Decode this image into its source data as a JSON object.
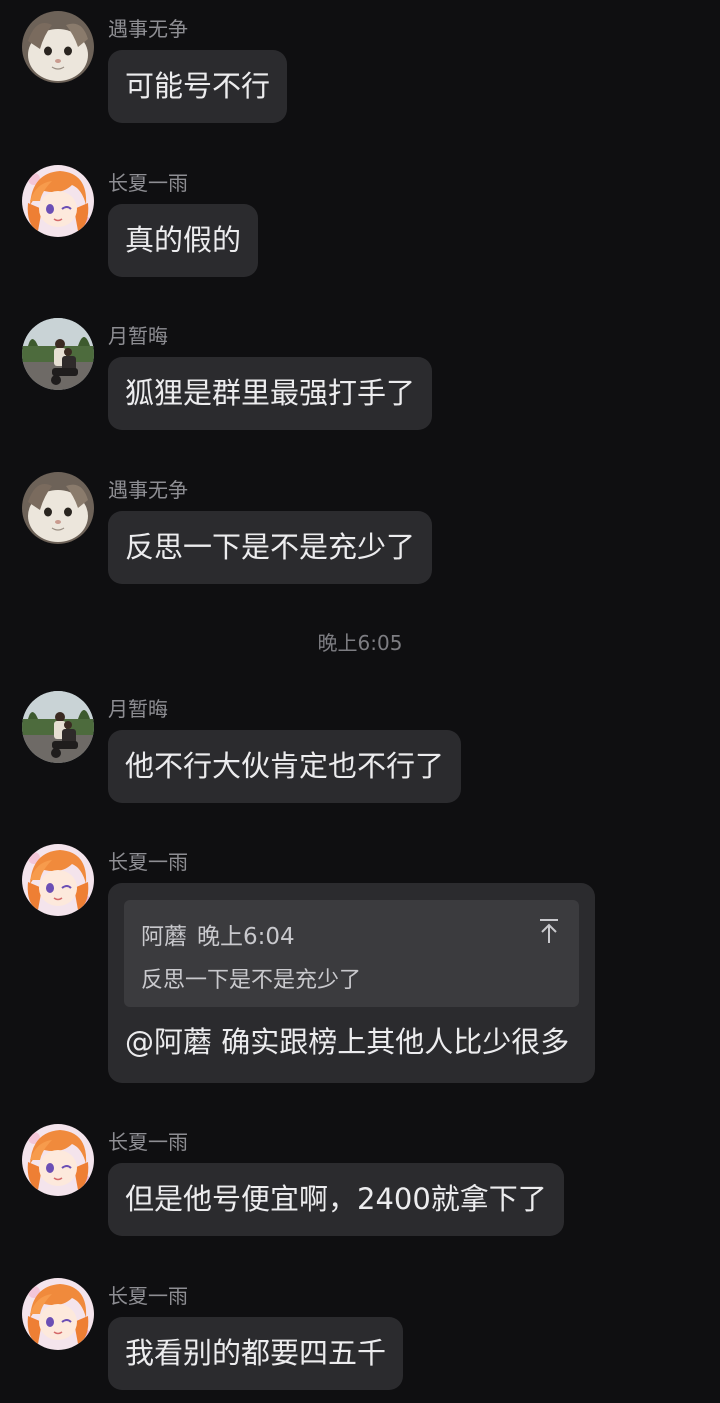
{
  "colors": {
    "background": "#0f0f11",
    "bubble": "#2b2b2e",
    "quote_bg": "#3b3b3e",
    "sender_text": "#8e8e93",
    "message_text": "#ececee"
  },
  "messages": [
    {
      "sender": "遇事无争",
      "text": "可能号不行",
      "avatar": "cat-avatar"
    },
    {
      "sender": "长夏一雨",
      "text": "真的假的",
      "avatar": "anime-girl-avatar"
    },
    {
      "sender": "月暂晦",
      "text": "狐狸是群里最强打手了",
      "avatar": "photo-avatar"
    },
    {
      "sender": "遇事无争",
      "text": "反思一下是不是充少了",
      "avatar": "cat-avatar"
    },
    {
      "sender": "月暂晦",
      "text": "他不行大伙肯定也不行了",
      "avatar": "photo-avatar"
    },
    {
      "sender": "长夏一雨",
      "avatar": "anime-girl-avatar",
      "quote": {
        "author": "阿蘑",
        "time": "晚上6:04",
        "text": "反思一下是不是充少了",
        "jump_icon": "scroll-to-top-icon"
      },
      "text": "@阿蘑 确实跟榜上其他人比少很多"
    },
    {
      "sender": "长夏一雨",
      "text": "但是他号便宜啊，2400就拿下了",
      "avatar": "anime-girl-avatar"
    },
    {
      "sender": "长夏一雨",
      "text": "我看别的都要四五千",
      "avatar": "anime-girl-avatar"
    }
  ],
  "time_divider": "晚上6:05"
}
